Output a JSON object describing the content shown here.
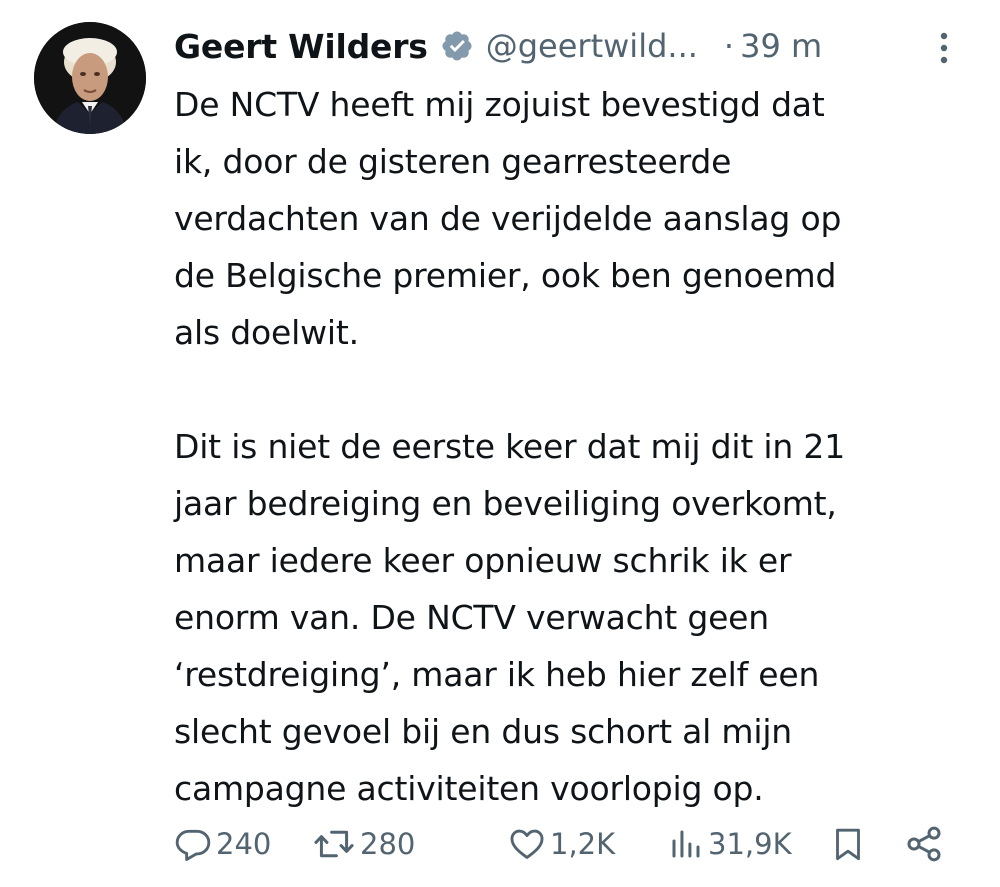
{
  "tweet": {
    "author_name": "Geert Wilders",
    "author_handle": "@geertwild...",
    "separator": "·",
    "time": "39 m",
    "text": "De NCTV heeft mij zojuist bevestigd dat\nik, door de gisteren gearresteerde\nverdachten van de verijdelde aanslag op\nde Belgische premier, ook ben genoemd\nals doelwit.\n\nDit is niet de eerste keer dat mij dit in 21\njaar bedreiging en beveiliging overkomt,\nmaar iedere keer opnieuw schrik ik er\nenorm van. De NCTV verwacht geen\n‘restdreiging’, maar ik heb hier zelf een\nslecht gevoel bij en dus schort al mijn\ncampagne activiteiten voorlopig op."
  },
  "actions": {
    "replies": "240",
    "reposts": "280",
    "likes": "1,2K",
    "views": "31,9K"
  },
  "icons": {
    "verified": "verified-badge-icon",
    "more": "more-vertical-icon",
    "reply": "reply-icon",
    "repost": "repost-icon",
    "like": "heart-icon",
    "views": "views-chart-icon",
    "bookmark": "bookmark-icon",
    "share": "share-icon"
  },
  "colors": {
    "text": "#0f1419",
    "secondary": "#536471",
    "verified_badge": "#829aab"
  }
}
